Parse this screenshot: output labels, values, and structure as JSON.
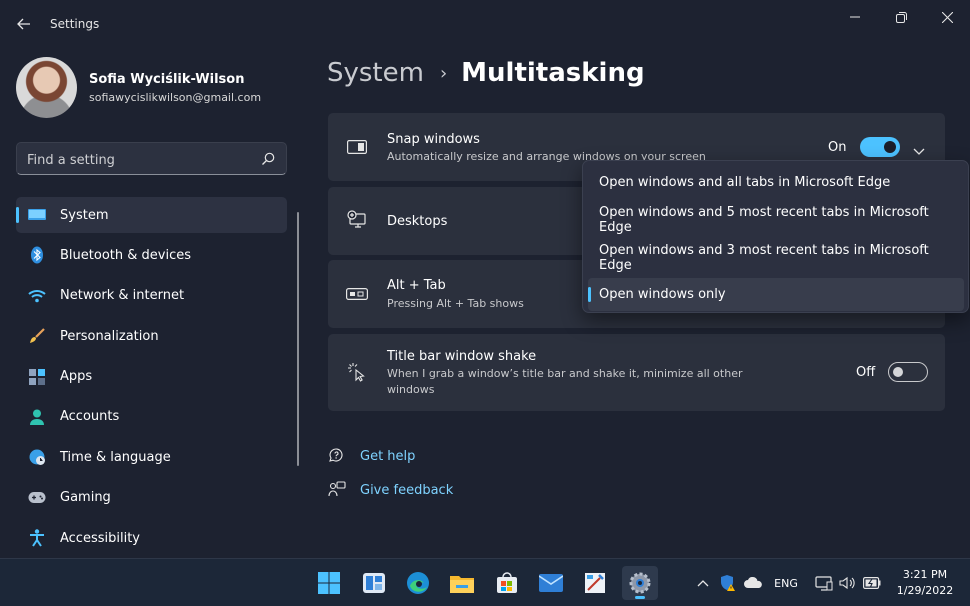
{
  "window": {
    "title": "Settings"
  },
  "profile": {
    "name": "Sofia Wyciślik-Wilson",
    "email": "sofiawycislikwilson@gmail.com"
  },
  "search": {
    "placeholder": "Find a setting"
  },
  "nav": {
    "active": "System",
    "items": [
      {
        "label": "System",
        "icon": "monitor-icon"
      },
      {
        "label": "Bluetooth & devices",
        "icon": "bluetooth-icon"
      },
      {
        "label": "Network & internet",
        "icon": "wifi-icon"
      },
      {
        "label": "Personalization",
        "icon": "brush-icon"
      },
      {
        "label": "Apps",
        "icon": "apps-icon"
      },
      {
        "label": "Accounts",
        "icon": "person-icon"
      },
      {
        "label": "Time & language",
        "icon": "globe-clock-icon"
      },
      {
        "label": "Gaming",
        "icon": "gamepad-icon"
      },
      {
        "label": "Accessibility",
        "icon": "accessibility-icon"
      }
    ]
  },
  "breadcrumb": {
    "parent": "System",
    "separator": "›",
    "current": "Multitasking"
  },
  "cards": {
    "snap": {
      "title": "Snap windows",
      "desc": "Automatically resize and arrange windows on your screen",
      "state": "On"
    },
    "desktops": {
      "title": "Desktops"
    },
    "alttab": {
      "title": "Alt + Tab",
      "desc": "Pressing Alt + Tab shows"
    },
    "shake": {
      "title": "Title bar window shake",
      "desc1": "When I grab a window’s title bar and shake it, minimize all other",
      "desc2": "windows",
      "state": "Off"
    }
  },
  "dropdown": {
    "options": [
      "Open windows and all tabs in Microsoft Edge",
      "Open windows and 5 most recent tabs in Microsoft Edge",
      "Open windows and 3 most recent tabs in Microsoft Edge",
      "Open windows only"
    ],
    "selected": "Open windows only"
  },
  "links": {
    "help": "Get help",
    "feedback": "Give feedback"
  },
  "taskbar": {
    "apps": [
      "start-icon",
      "widgets-icon",
      "edge-icon",
      "file-explorer-icon",
      "store-icon",
      "mail-icon",
      "paint-icon",
      "settings-icon"
    ],
    "tray": {
      "language": "ENG"
    },
    "clock": {
      "time": "3:21 PM",
      "date": "1/29/2022"
    }
  },
  "colors": {
    "accent": "#4cc2ff",
    "background": "#1d2230",
    "card": "#2b303d",
    "link": "#7fd3ff"
  }
}
